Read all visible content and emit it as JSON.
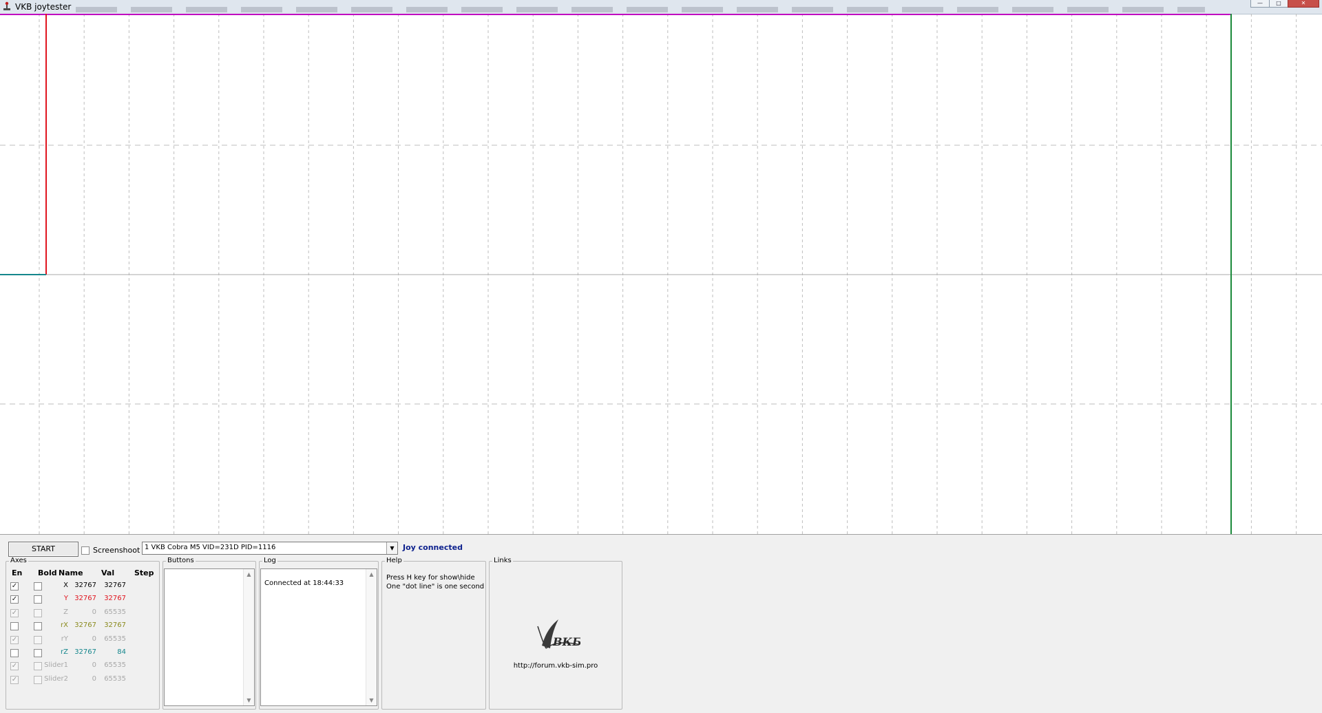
{
  "window": {
    "title": "VKB joytester"
  },
  "controls": {
    "start_label": "START",
    "screenshot_label": "Screenshoot",
    "device_selected": "1 VKB Cobra M5 VID=231D PID=1116",
    "joy_status": "Joy connected"
  },
  "axes": {
    "title": "Axes",
    "headers": {
      "en": "En",
      "bold": "Bold",
      "name": "Name",
      "val": "Val",
      "step": "Step"
    },
    "rows": [
      {
        "name": "X",
        "val": "32767",
        "step": "32767",
        "en": true,
        "enabled": true,
        "color": "#000000"
      },
      {
        "name": "Y",
        "val": "32767",
        "step": "32767",
        "en": true,
        "enabled": true,
        "color": "#e0141e"
      },
      {
        "name": "Z",
        "val": "0",
        "step": "65535",
        "en": true,
        "enabled": false,
        "color": "#a8a8a8"
      },
      {
        "name": "rX",
        "val": "32767",
        "step": "32767",
        "en": false,
        "enabled": true,
        "color": "#8a8a1e"
      },
      {
        "name": "rY",
        "val": "0",
        "step": "65535",
        "en": true,
        "enabled": false,
        "color": "#a8a8a8"
      },
      {
        "name": "rZ",
        "val": "32767",
        "step": "84",
        "en": false,
        "enabled": true,
        "color": "#14868c"
      },
      {
        "name": "Slider1",
        "val": "0",
        "step": "65535",
        "en": true,
        "enabled": false,
        "color": "#a8a8a8"
      },
      {
        "name": "Slider2",
        "val": "0",
        "step": "65535",
        "en": true,
        "enabled": false,
        "color": "#a8a8a8"
      }
    ]
  },
  "buttons_group": {
    "title": "Buttons"
  },
  "log": {
    "title": "Log",
    "lines": [
      "Connected at 18:44:33"
    ]
  },
  "help": {
    "title": "Help",
    "lines": [
      "Press H key for show\\hide",
      "One \"dot line\" is one second"
    ]
  },
  "links": {
    "title": "Links",
    "logo_text": "ВКБ",
    "url": "http://forum.vkb-sim.pro"
  },
  "colors": {
    "top_trace": "#c000c0",
    "x_trace": "#e0141e",
    "rz_trace": "#14868c",
    "cursor_line": "#1a8a3a",
    "joy_status": "#0b1f8c"
  }
}
